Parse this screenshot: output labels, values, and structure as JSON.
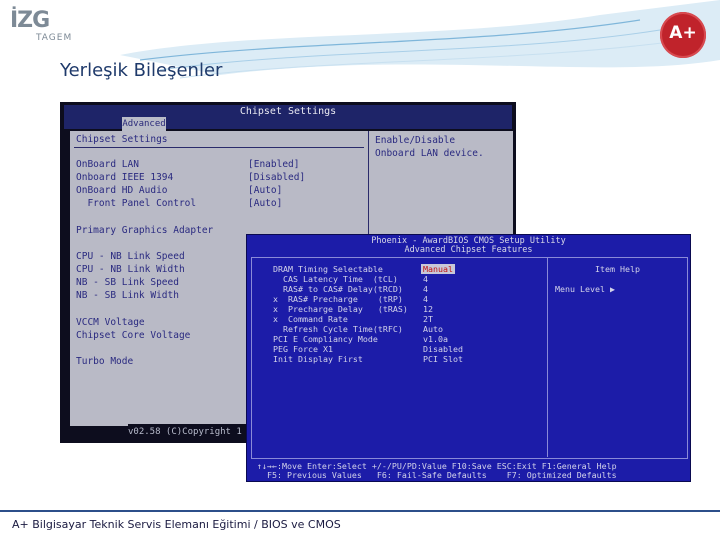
{
  "header": {
    "logo_main": "İZG",
    "logo_sub": "TAGEM",
    "seal_text": "A+",
    "title": "Yerleşik Bileşenler"
  },
  "bios1": {
    "window_title": "Chipset Settings",
    "tab": "Advanced",
    "section_title": "Chipset Settings",
    "items": [
      {
        "label": "OnBoard LAN",
        "value": "[Enabled]"
      },
      {
        "label": "Onboard IEEE 1394",
        "value": "[Disabled]"
      },
      {
        "label": "OnBoard HD Audio",
        "value": "[Auto]"
      },
      {
        "label": "  Front Panel Control",
        "value": "[Auto]"
      }
    ],
    "groups": [
      "Primary Graphics Adapter",
      "CPU - NB Link Speed",
      "CPU - NB Link Width",
      "NB - SB Link Speed",
      "NB - SB Link Width",
      "VCCM Voltage",
      "Chipset Core Voltage",
      "Turbo Mode"
    ],
    "help_line1": "Enable/Disable",
    "help_line2": "Onboard LAN device.",
    "footer": "v02.58 (C)Copyright 1"
  },
  "bios2": {
    "title1": "Phoenix - AwardBIOS CMOS Setup Utility",
    "title2": "Advanced Chipset Features",
    "rows": [
      {
        "label": "DRAM Timing Selectable",
        "value": "Manual"
      },
      {
        "label": "  CAS Latency Time  (tCL)",
        "value": "4"
      },
      {
        "label": "  RAS# to CAS# Delay(tRCD)",
        "value": "4"
      },
      {
        "label": "x  RAS# Precharge    (tRP)",
        "value": "4"
      },
      {
        "label": "x  Precharge Delay   (tRAS)",
        "value": "12"
      },
      {
        "label": "x  Command Rate",
        "value": "2T"
      },
      {
        "label": "  Refresh Cycle Time(tRFC)",
        "value": "Auto"
      },
      {
        "label": "PCI E Compliancy Mode",
        "value": "v1.0a"
      },
      {
        "label": "PEG Force X1",
        "value": "Disabled"
      },
      {
        "label": "Init Display First",
        "value": "PCI Slot"
      }
    ],
    "item_help": "Item Help",
    "menu_level": "Menu Level   ▶",
    "footer_line1": "↑↓→←:Move  Enter:Select  +/-/PU/PD:Value  F10:Save  ESC:Exit  F1:General Help",
    "footer_line2": "  F5: Previous Values   F6: Fail-Safe Defaults    F7: Optimized Defaults"
  },
  "footer": {
    "caption": "A+ Bilgisayar Teknik Servis Elemanı Eğitimi / BIOS ve CMOS"
  },
  "colors": {
    "accent": "#2c4f8a",
    "bios_blue": "#1c1ca8",
    "seal_red": "#c0232b"
  }
}
